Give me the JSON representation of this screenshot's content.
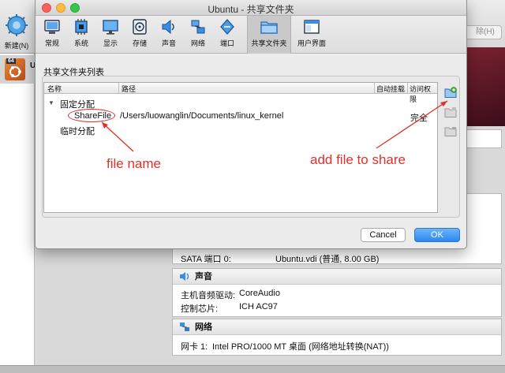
{
  "manager": {
    "new_label": "新建(N)",
    "right_button_fragment": "除(H)",
    "vm_badge": "64",
    "vm_initial": "U",
    "storage_row": {
      "key": "SATA 端口 0:",
      "value": "Ubuntu.vdi (普通, 8.00 GB)"
    },
    "audio": {
      "title": "声音",
      "rows": [
        {
          "key": "主机音频驱动:",
          "value": "CoreAudio"
        },
        {
          "key": "控制芯片:",
          "value": "ICH AC97"
        }
      ]
    },
    "network": {
      "title": "网络",
      "rows": [
        {
          "key": "网卡 1:",
          "value": "Intel PRO/1000 MT 桌面 (网络地址转换(NAT))"
        }
      ]
    }
  },
  "dialog": {
    "title": "Ubuntu - 共享文件夹",
    "tabs": [
      {
        "id": "general",
        "label": "常规",
        "icon": "general-icon"
      },
      {
        "id": "system",
        "label": "系统",
        "icon": "chip-icon"
      },
      {
        "id": "display",
        "label": "显示",
        "icon": "monitor-icon"
      },
      {
        "id": "storage",
        "label": "存储",
        "icon": "disk-icon"
      },
      {
        "id": "audio",
        "label": "声音",
        "icon": "speaker-icon"
      },
      {
        "id": "network",
        "label": "网络",
        "icon": "network-icon"
      },
      {
        "id": "ports",
        "label": "端口",
        "icon": "port-icon"
      },
      {
        "id": "shared-folders",
        "label": "共享文件夹",
        "icon": "folder-icon",
        "active": true
      },
      {
        "id": "ui",
        "label": "用户界面",
        "icon": "window-icon"
      }
    ],
    "section_title": "共享文件夹列表",
    "columns": {
      "name": "名称",
      "path": "路径",
      "automount": "自动挂载",
      "access": "访问权限"
    },
    "groups": [
      {
        "label": "固定分配",
        "expanded": true,
        "items": [
          {
            "name": "ShareFile",
            "path": "/Users/luowanglin/Documents/linux_kernel",
            "automount": "",
            "access": "完全"
          }
        ]
      },
      {
        "label": "临时分配",
        "items": []
      }
    ],
    "side_buttons": [
      "add-folder-icon",
      "edit-folder-icon",
      "remove-folder-icon"
    ],
    "cancel_label": "Cancel",
    "ok_label": "OK"
  },
  "annotations": {
    "file_name": "file name",
    "add_file": "add file to share",
    "color": "#e0302a"
  }
}
